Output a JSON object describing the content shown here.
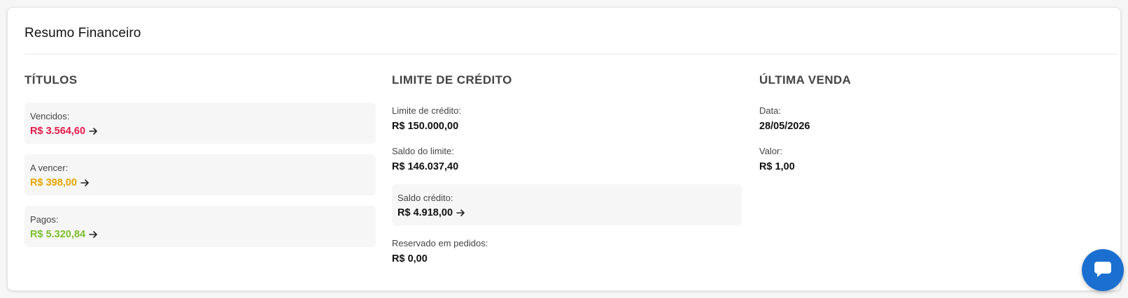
{
  "card": {
    "title": "Resumo Financeiro"
  },
  "titulos": {
    "heading": "TÍTULOS",
    "items": [
      {
        "label": "Vencidos:",
        "value": "R$ 3.564,60",
        "color": "#e5194a"
      },
      {
        "label": "A vencer:",
        "value": "R$ 398,00",
        "color": "#e5a500"
      },
      {
        "label": "Pagos:",
        "value": "R$ 5.320,84",
        "color": "#7bbf2a"
      }
    ]
  },
  "limite": {
    "heading": "LIMITE DE CRÉDITO",
    "limite_credito": {
      "label": "Limite de crédito:",
      "value": "R$ 150.000,00"
    },
    "saldo_limite": {
      "label": "Saldo do limite:",
      "value": "R$ 146.037,40"
    },
    "saldo_credito": {
      "label": "Saldo crédito:",
      "value": "R$ 4.918,00"
    },
    "reservado": {
      "label": "Reservado em pedidos:",
      "value": "R$ 0,00"
    }
  },
  "ultima_venda": {
    "heading": "ÚLTIMA VENDA",
    "data": {
      "label": "Data:",
      "value": "28/05/2026"
    },
    "valor": {
      "label": "Valor:",
      "value": "R$ 1,00"
    }
  },
  "chat": {
    "icon": "chat-bubble-icon",
    "color": "#1b6fd0"
  }
}
